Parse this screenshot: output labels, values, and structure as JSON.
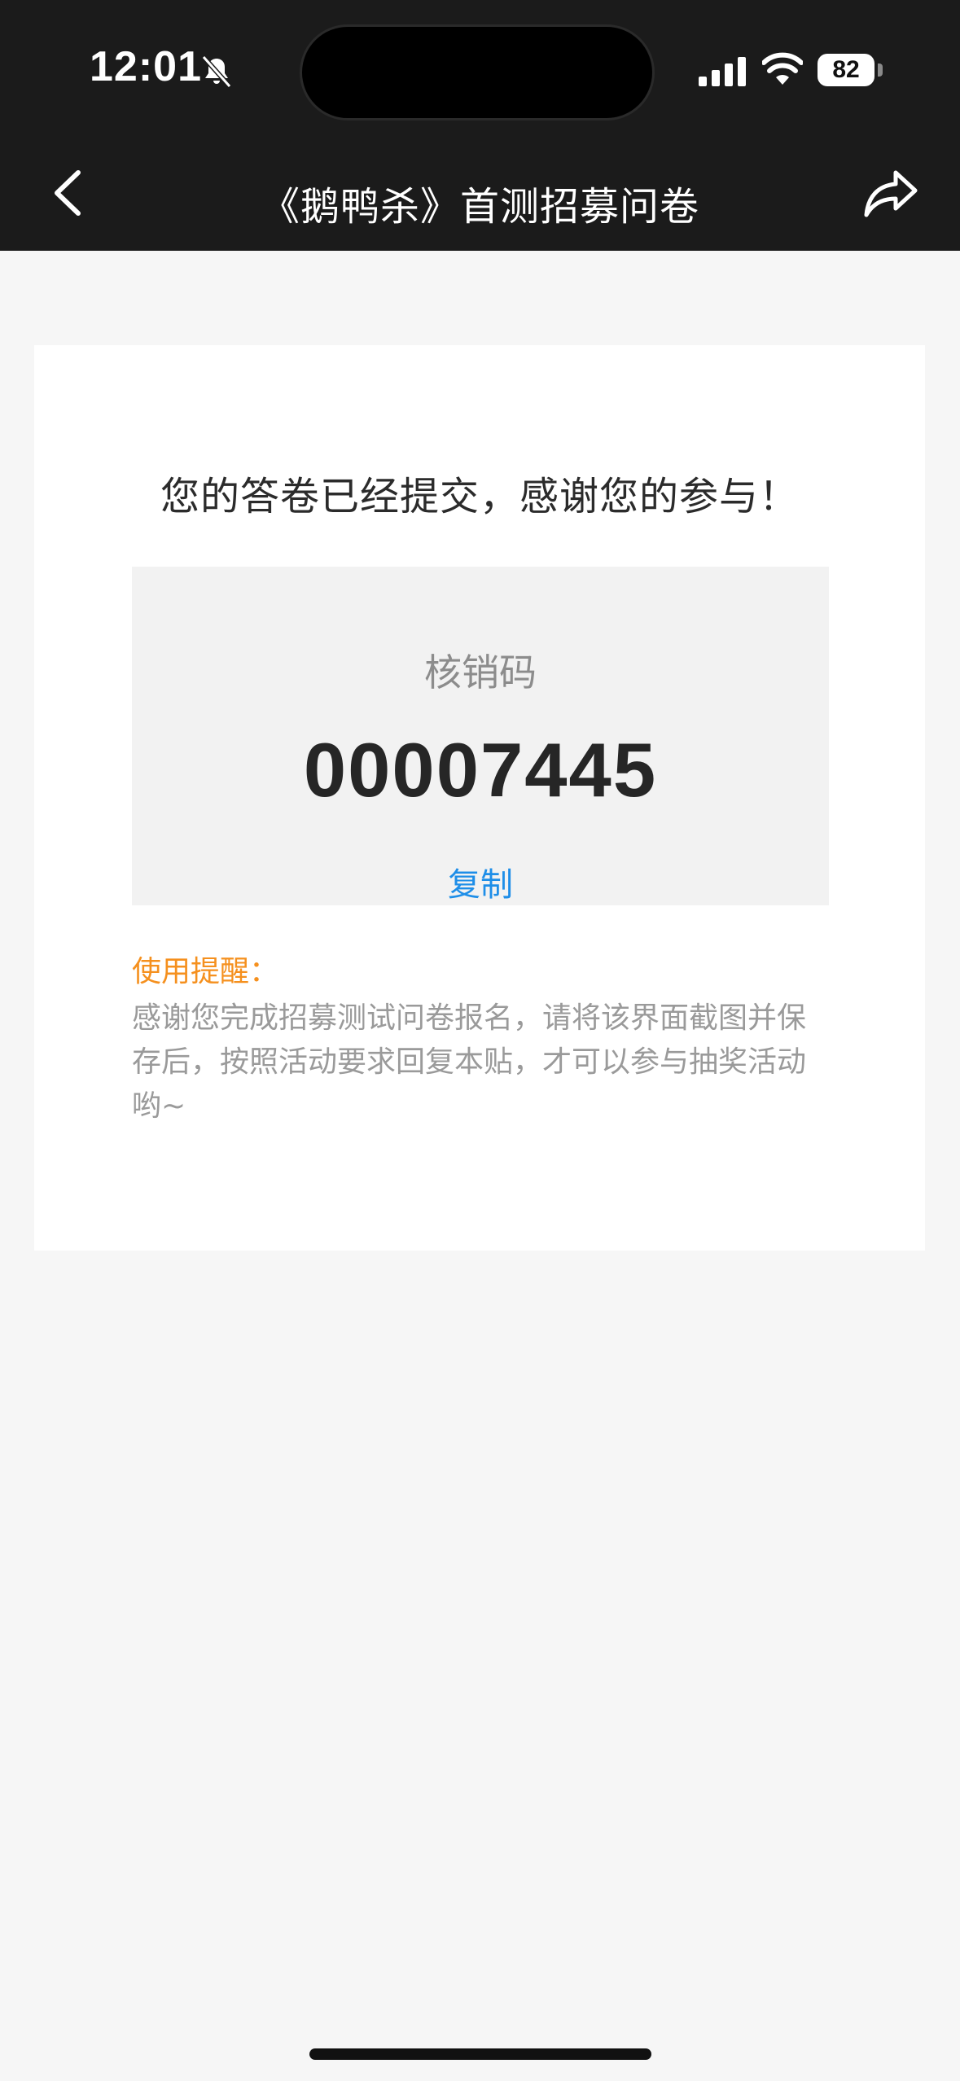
{
  "status_bar": {
    "time": "12:01",
    "battery_level": "82",
    "icons": [
      "bell-slash-icon",
      "signal-icon",
      "wifi-icon",
      "battery-icon"
    ]
  },
  "nav": {
    "title": "《鹅鸭杀》首测招募问卷",
    "back_icon": "chevron-left-icon",
    "share_icon": "share-icon"
  },
  "result": {
    "message": "您的答卷已经提交，感谢您的参与！",
    "code_label": "核销码",
    "code_value": "00007445",
    "copy_label": "复制"
  },
  "reminder": {
    "title": "使用提醒：",
    "text": "感谢您完成招募测试问卷报名，请将该界面截图并保存后，按照活动要求回复本贴，才可以参与抽奖活动哟~"
  },
  "colors": {
    "header_bg": "#1b1b1b",
    "page_bg": "#f6f6f6",
    "link_blue": "#1e8ee8",
    "reminder_orange": "#f5901e"
  }
}
